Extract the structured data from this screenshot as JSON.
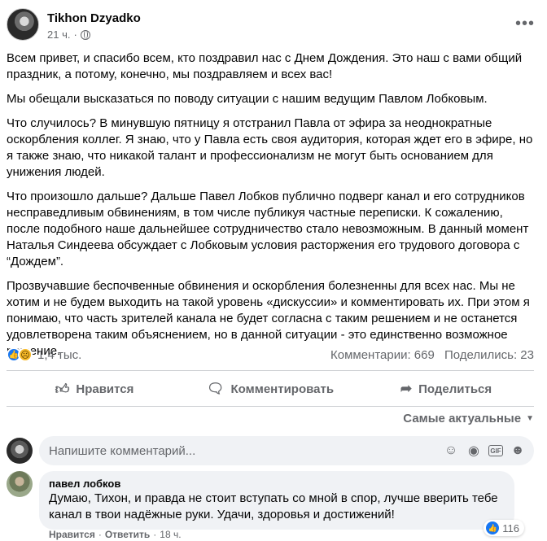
{
  "post": {
    "author": "Tikhon Dzyadko",
    "time": "21 ч.",
    "dot": "·",
    "paragraphs": [
      "Всем привет, и спасибо всем, кто поздравил нас с Днем Дождения. Это наш с вами общий праздник, а потому, конечно, мы поздравляем и всех вас!",
      "Мы обещали высказаться по поводу ситуации с нашим ведущим Павлом Лобковым.",
      "Что случилось? В минувшую пятницу я отстранил Павла от эфира за неоднократные оскорбления коллег. Я знаю, что у Павла есть своя аудитория, которая ждет его в эфире, но я также знаю, что никакой талант и профессионализм не могут быть основанием для унижения людей.",
      "Что произошло дальше? Дальше Павел Лобков публично подверг канал и его сотрудников несправедливым обвинениям, в том числе публикуя частные переписки. К сожалению, после подобного наше дальнейшее сотрудничество стало  невозможным. В данный момент Наталья Синдеева обсуждает с Лобковым условия расторжения его трудового договора с “Дождем”.",
      "Прозвучавшие беспочвенные обвинения и оскорбления болезненны для всех нас. Мы не хотим и не будем выходить на такой уровень «дискуссии» и комментировать их. При этом я понимаю, что часть зрителей канала не будет согласна с таким решением и не останется удовлетворена таким объяснением, но в данной ситуации - это единственно возможное решение."
    ]
  },
  "reactions": {
    "count": "1,4 тыс.",
    "comments": "Комментарии: 669",
    "shares": "Поделились: 23"
  },
  "actions": {
    "like": "Нравится",
    "comment": "Комментировать",
    "share": "Поделиться"
  },
  "sort": {
    "label": "Самые актуальные",
    "chevron": "▼"
  },
  "composer": {
    "placeholder": "Напишите комментарий...",
    "gif": "GIF"
  },
  "comment": {
    "name": "павел лобков",
    "text": "Думаю, Тихон, и правда не стоит вступать со мной в спор, лучше вверить тебе канал в твои надёжные руки. Удачи, здоровья и достижений!",
    "likes": "116",
    "like_link": "Нравится",
    "reply_link": "Ответить",
    "time": "18 ч.",
    "dot": "·"
  },
  "colors": {
    "like_blue": "#1877f2",
    "sad_yellow": "#f7b928",
    "secondary_text": "#65676b",
    "bubble_bg": "#f0f2f5"
  },
  "icons": [
    "globe-icon",
    "more-icon",
    "like-icon",
    "sad-icon",
    "comment-icon",
    "share-icon",
    "emoji-icon",
    "camera-icon",
    "gif-icon",
    "sticker-icon",
    "chevron-down-icon"
  ]
}
